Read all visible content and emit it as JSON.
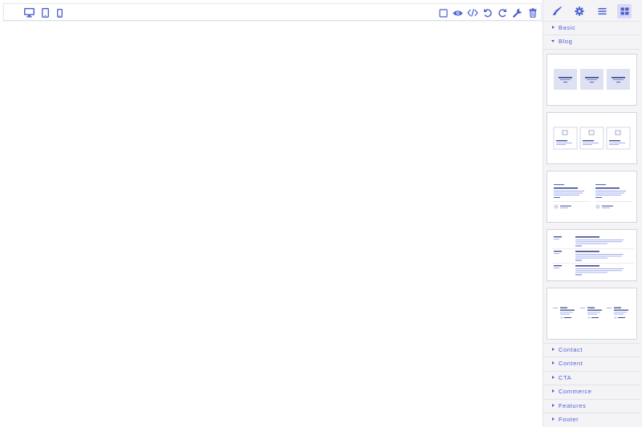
{
  "toolbar": {
    "devices": [
      {
        "icon": "desktop-icon",
        "active": true
      },
      {
        "icon": "tablet-icon",
        "active": false
      },
      {
        "icon": "mobile-icon",
        "active": false
      }
    ],
    "actions": [
      "square-outline-icon",
      "eye-icon",
      "code-icon",
      "undo-icon",
      "redo-icon",
      "wrench-icon",
      "trash-icon"
    ]
  },
  "panel": {
    "tabs": [
      {
        "icon": "paint-brush-icon",
        "active": false
      },
      {
        "icon": "gear-icon",
        "active": false
      },
      {
        "icon": "layers-icon",
        "active": false
      },
      {
        "icon": "blocks-grid-icon",
        "active": true
      }
    ],
    "categories_top": [
      {
        "label": "Basic",
        "expanded": false
      },
      {
        "label": "Blog",
        "expanded": true
      }
    ],
    "blog_blocks": [
      {
        "icon": "blog-block-1-icon"
      },
      {
        "icon": "blog-block-2-icon"
      },
      {
        "icon": "blog-block-3-icon"
      },
      {
        "icon": "blog-block-4-icon"
      },
      {
        "icon": "blog-block-5-icon"
      }
    ],
    "categories_bottom": [
      {
        "label": "Contact",
        "expanded": false
      },
      {
        "label": "Content",
        "expanded": false
      },
      {
        "label": "CTA",
        "expanded": false
      },
      {
        "label": "Commerce",
        "expanded": false
      },
      {
        "label": "Features",
        "expanded": false
      },
      {
        "label": "Footer",
        "expanded": false
      }
    ]
  },
  "colors": {
    "accent": "#4a5fd0",
    "active_tab_bg": "#d8dbf3",
    "panel_bg": "#f4f4f7",
    "thumb_line": "#3b4a8a",
    "thumb_light": "#9aa8e8"
  }
}
